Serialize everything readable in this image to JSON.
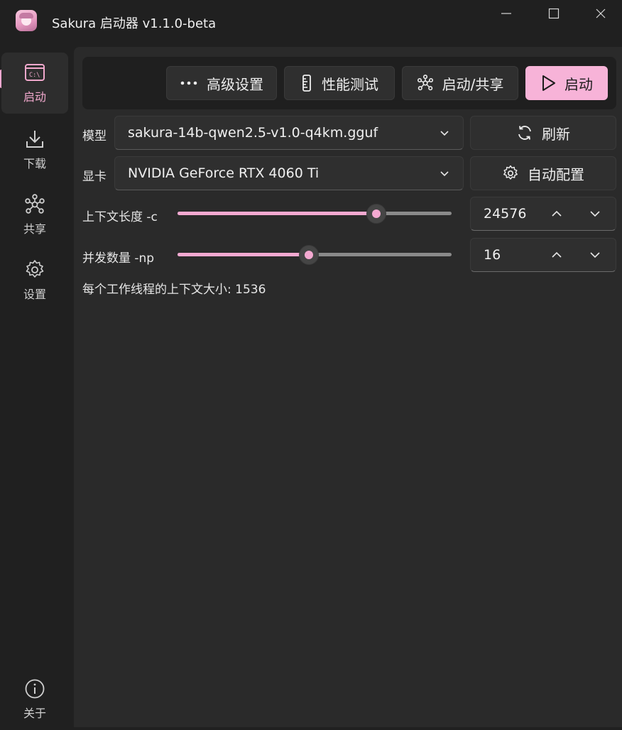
{
  "app": {
    "title": "Sakura 启动器 v1.1.0-beta"
  },
  "sidebar": {
    "items": [
      {
        "label": "启动",
        "icon": "terminal-icon",
        "active": true
      },
      {
        "label": "下载",
        "icon": "download-icon"
      },
      {
        "label": "共享",
        "icon": "network-icon"
      },
      {
        "label": "设置",
        "icon": "gear-icon"
      }
    ],
    "about": {
      "label": "关于",
      "icon": "info-icon"
    }
  },
  "toolbar": {
    "advanced_label": "高级设置",
    "benchmark_label": "性能测试",
    "start_share_label": "启动/共享",
    "start_label": "启动"
  },
  "form": {
    "model_label": "模型",
    "model_value": "sakura-14b-qwen2.5-v1.0-q4km.gguf",
    "refresh_label": "刷新",
    "gpu_label": "显卡",
    "gpu_value": "NVIDIA GeForce RTX 4060 Ti",
    "autoconfig_label": "自动配置",
    "context_label": "上下文长度 -c",
    "context_value": "24576",
    "context_slider_fraction": 0.725,
    "parallel_label": "并发数量 -np",
    "parallel_value": "16",
    "parallel_slider_fraction": 0.48,
    "per_thread_info": "每个工作线程的上下文大小: 1536"
  },
  "colors": {
    "accent": "#f4a9d1",
    "background": "#202020",
    "panel": "#2a2a2a"
  }
}
